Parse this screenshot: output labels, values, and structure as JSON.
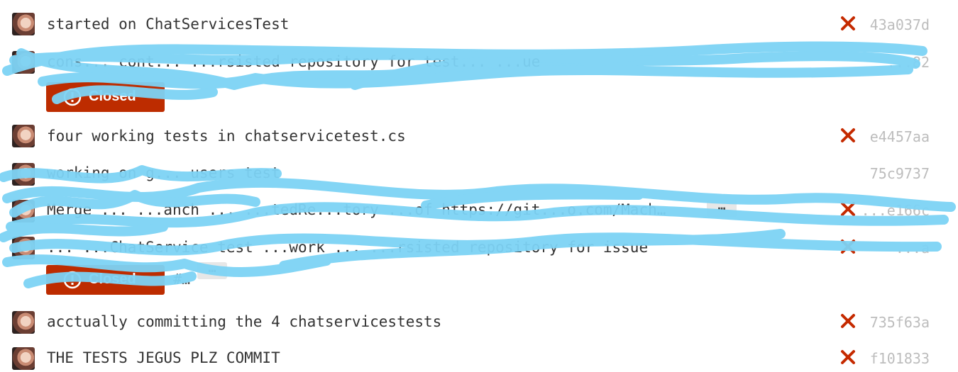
{
  "commits": [
    {
      "message": "started on ChatServicesTest",
      "sha": "43a037d",
      "status": "failed"
    },
    {
      "message": "cons... cont... ...rsisted repository for test... ...ue",
      "sha": "...82",
      "status": "failed",
      "badge": "Closed"
    },
    {
      "message": "four working tests in chatservicetest.cs",
      "sha": "e4457aa",
      "status": "failed"
    },
    {
      "message": "working on g... users test",
      "sha": "75c9737",
      "status": "none"
    },
    {
      "message": "Merge ... ...anch ... ...tedRe...tory ...of https://git...o.com/Mach…",
      "sha": "...e166c",
      "status": "failed"
    },
    {
      "message": "... ...ChatService test ...work ... ...rsisted repository for issue",
      "sha": "...a",
      "status": "failed",
      "badge": "Closed",
      "issue_ref": "#…"
    },
    {
      "message": "acctually committing the 4 chatservicestests",
      "sha": "735f63a",
      "status": "failed"
    },
    {
      "message": "THE TESTS JEGUS PLZ COMMIT",
      "sha": "f101833",
      "status": "failed"
    }
  ],
  "ellipsis": "…",
  "colors": {
    "fail": "#c52a00",
    "badge": "#bd2c00",
    "sha": "#bdbdbd",
    "scribble": "#7dd3f5"
  }
}
